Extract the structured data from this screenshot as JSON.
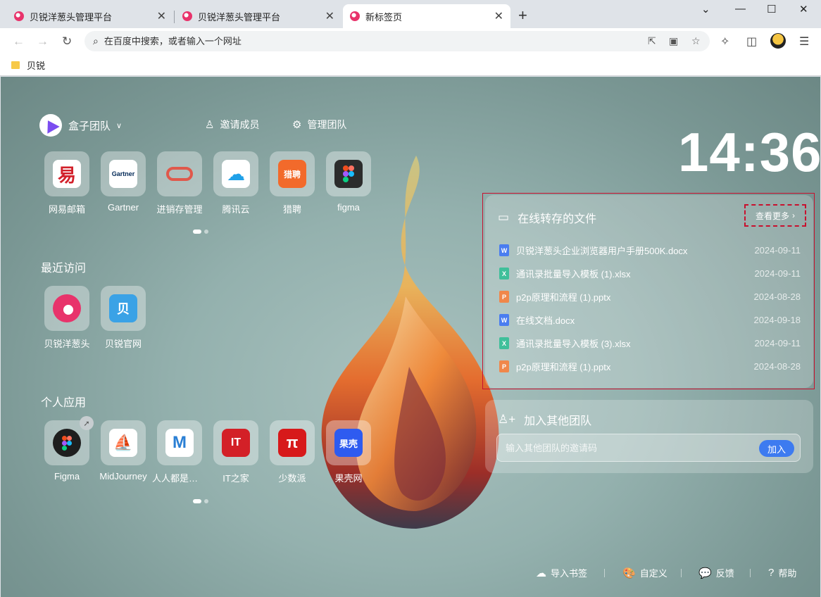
{
  "tabs": [
    {
      "title": "贝锐洋葱头管理平台",
      "active": false
    },
    {
      "title": "贝锐洋葱头管理平台",
      "active": false
    },
    {
      "title": "新标签页",
      "active": true
    }
  ],
  "window_controls": {
    "chevron": "⌄",
    "minimize": "—",
    "maximize": "☐",
    "close": "✕"
  },
  "omnibox": {
    "placeholder": "在百度中搜索，或者输入一个网址"
  },
  "bookmarks": [
    {
      "label": "贝锐"
    }
  ],
  "team": {
    "name": "盒子团队",
    "invite": "邀请成员",
    "manage": "管理团队",
    "apps": [
      {
        "label": "网易邮箱",
        "icon": "wangyi-mail-icon",
        "color": "#ffffff"
      },
      {
        "label": "Gartner",
        "icon": "gartner-icon",
        "color": "#ffffff"
      },
      {
        "label": "进销存管理",
        "icon": "oracle-icon",
        "color": "#e0584b"
      },
      {
        "label": "腾讯云",
        "icon": "tencent-cloud-icon",
        "color": "#ffffff"
      },
      {
        "label": "猎聘",
        "icon": "liepin-icon",
        "color": "#f26a2b"
      },
      {
        "label": "figma",
        "icon": "figma-icon",
        "color": "#2c2c2c"
      }
    ]
  },
  "recent": {
    "title": "最近访问",
    "apps": [
      {
        "label": "贝锐洋葱头",
        "icon": "onion-icon"
      },
      {
        "label": "贝锐官网",
        "icon": "beirui-icon"
      }
    ]
  },
  "personal": {
    "title": "个人应用",
    "apps": [
      {
        "label": "Figma",
        "icon": "figma-icon"
      },
      {
        "label": "MidJourney",
        "icon": "midjourney-icon"
      },
      {
        "label": "人人都是产品经理",
        "icon": "renren-icon"
      },
      {
        "label": "IT之家",
        "icon": "ithome-icon"
      },
      {
        "label": "少数派",
        "icon": "sspai-icon"
      },
      {
        "label": "果壳网",
        "icon": "guokr-icon"
      }
    ]
  },
  "clock": "14:36",
  "files_panel": {
    "title": "在线转存的文件",
    "more": "查看更多",
    "files": [
      {
        "name": "贝锐洋葱头企业浏览器用户手册500K.docx",
        "date": "2024-09-11",
        "type": "W",
        "color": "#4a7df0"
      },
      {
        "name": "通讯录批量导入模板 (1).xlsx",
        "date": "2024-09-11",
        "type": "X",
        "color": "#3fbf9a"
      },
      {
        "name": "p2p原理和流程 (1).pptx",
        "date": "2024-08-28",
        "type": "P",
        "color": "#f0874a"
      },
      {
        "name": "在线文档.docx",
        "date": "2024-09-18",
        "type": "W",
        "color": "#4a7df0"
      },
      {
        "name": "通讯录批量导入模板 (3).xlsx",
        "date": "2024-09-11",
        "type": "X",
        "color": "#3fbf9a"
      },
      {
        "name": "p2p原理和流程 (1).pptx",
        "date": "2024-08-28",
        "type": "P",
        "color": "#f0874a"
      }
    ]
  },
  "join_panel": {
    "title": "加入其他团队",
    "placeholder": "输入其他团队的邀请码",
    "button": "加入"
  },
  "footer": {
    "import_bookmarks": "导入书签",
    "customize": "自定义",
    "feedback": "反馈",
    "help": "帮助"
  }
}
